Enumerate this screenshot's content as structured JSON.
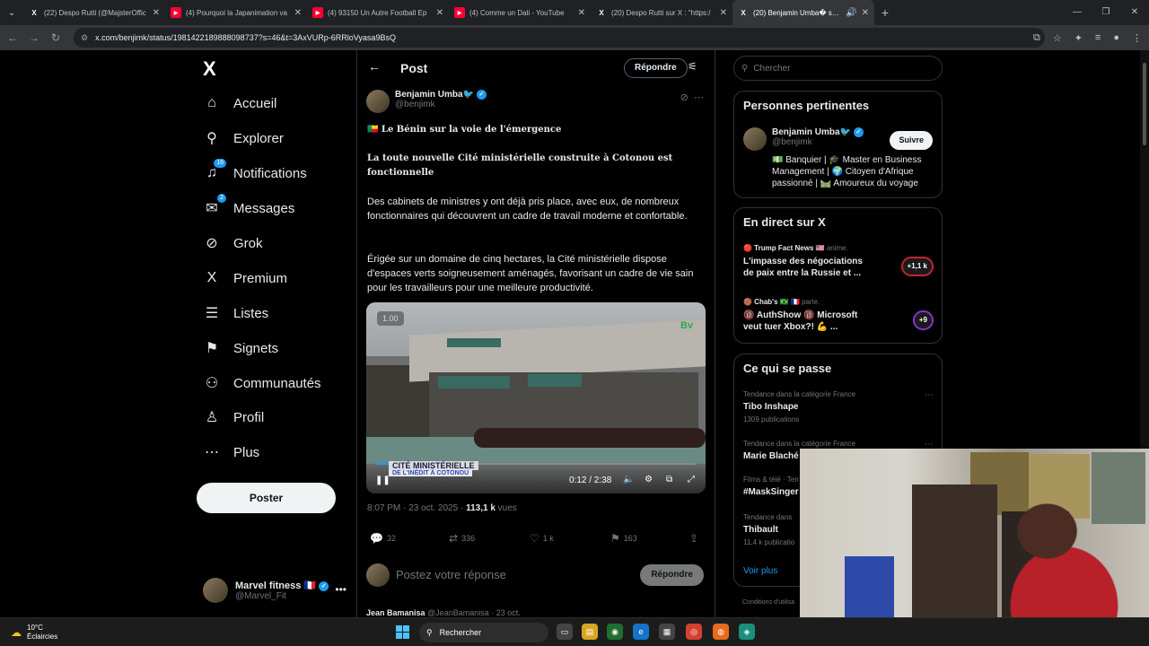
{
  "browser": {
    "tabs": [
      {
        "icon": "x-icon",
        "title": "(22) Despo Rutti (@MajsterOffic",
        "active": false
      },
      {
        "icon": "youtube-icon",
        "title": "(4) Pourquoi la Japanimation va",
        "active": false
      },
      {
        "icon": "youtube-icon",
        "title": "(4) 93150 Un Autre Football Ep",
        "active": false
      },
      {
        "icon": "youtube-icon",
        "title": "(4) Comme un Dali - YouTube",
        "active": false
      },
      {
        "icon": "x-icon",
        "title": "(20) Despo Rutti sur X : \"https:/",
        "active": false
      },
      {
        "icon": "x-icon",
        "title": "(20) Benjamin Umba� sur X",
        "active": true
      }
    ],
    "url": "x.com/benjimk/status/1981422189888098737?s=46&t=3AxVURp-6RRloVyasa9BsQ"
  },
  "nav": {
    "items": [
      {
        "label": "Accueil",
        "icon": "home-icon",
        "glyph": "⌂",
        "badge": ""
      },
      {
        "label": "Explorer",
        "icon": "search-icon",
        "glyph": "⚲",
        "badge": ""
      },
      {
        "label": "Notifications",
        "icon": "bell-icon",
        "glyph": "♫",
        "badge": "16"
      },
      {
        "label": "Messages",
        "icon": "mail-icon",
        "glyph": "✉",
        "badge": "2"
      },
      {
        "label": "Grok",
        "icon": "grok-icon",
        "glyph": "⊘",
        "badge": ""
      },
      {
        "label": "Premium",
        "icon": "x-icon",
        "glyph": "X",
        "badge": ""
      },
      {
        "label": "Listes",
        "icon": "list-icon",
        "glyph": "☰",
        "badge": ""
      },
      {
        "label": "Signets",
        "icon": "bookmark-icon",
        "glyph": "⚑",
        "badge": ""
      },
      {
        "label": "Communautés",
        "icon": "communities-icon",
        "glyph": "⚇",
        "badge": ""
      },
      {
        "label": "Profil",
        "icon": "profile-icon",
        "glyph": "♙",
        "badge": ""
      },
      {
        "label": "Plus",
        "icon": "more-icon",
        "glyph": "⋯",
        "badge": ""
      }
    ],
    "post_button": "Poster",
    "account": {
      "name": "Marvel fitness 🇫🇷",
      "handle": "@Marvel_Fit"
    }
  },
  "post": {
    "header_title": "Post",
    "header_reply": "Répondre",
    "author_name": "Benjamin Umba🐦",
    "author_handle": "@benjimk",
    "headline": "🇧🇯 Le Bénin sur la voie de l'émergence",
    "subheadline": "La toute nouvelle Cité ministérielle construite à Cotonou est fonctionnelle",
    "para1": "Des cabinets de ministres y ont déjà pris place, avec eux, de nombreux fonctionnaires qui découvrent un cadre de travail moderne et confortable.",
    "para2": "Érigée sur un domaine de cinq hectares, la Cité ministérielle dispose d'espaces verts soigneusement aménagés, favorisant un cadre de vie sain pour les travailleurs pour une meilleure productivité.",
    "video": {
      "speed": "1.00",
      "brand": "Bv",
      "caption1": "CITÉ MINISTÉRIELLE",
      "caption2": "DE L'INÉDIT À COTONOU",
      "time": "0:12 / 2:38",
      "progress": 0.076
    },
    "meta_time": "8:07 PM · 23 oct. 2025 · ",
    "views_count": "113,1 k",
    "views_label": " vues",
    "stats": {
      "replies": "32",
      "reposts": "336",
      "likes": "1 k",
      "bookmarks": "163"
    },
    "reply_placeholder": "Postez votre réponse",
    "reply_button": "Répondre",
    "next_reply_name": "Jean Bamanisa",
    "next_reply_meta": " @JeanBamanisa · 23 oct."
  },
  "sidebar": {
    "search_placeholder": "Chercher",
    "relevant": {
      "title": "Personnes pertinentes",
      "name": "Benjamin Umba🐦",
      "handle": "@benjimk",
      "follow": "Suivre",
      "bio": "💵 Banquier | 🎓 Master en Business Management | 🌍 Citoyen d'Afrique passionné | 🛤️ Amoureux du voyage"
    },
    "live": {
      "title": "En direct sur X",
      "items": [
        {
          "who": "🔴 Trump Fact News 🇺🇸 ",
          "role": "anime.",
          "title": "L'impasse des négociations de paix entre la Russie et ...",
          "badge": "+1,1 k"
        },
        {
          "who": "🟤 Chab's 🇧🇷 🇫🇷 ",
          "role": "parle.",
          "title": "🔞 AuthShow 🔞 Microsoft veut tuer Xbox?! 💪 ...",
          "badge": "+9"
        }
      ]
    },
    "trends": {
      "title": "Ce qui se passe",
      "items": [
        {
          "cat": "Tendance dans la catégorie France",
          "name": "Tibo Inshape",
          "posts": "1309 publications"
        },
        {
          "cat": "Tendance dans la catégorie France",
          "name": "Marie Blaché",
          "posts": ""
        },
        {
          "cat": "Films & télé · Ten",
          "name": "#MaskSinger",
          "posts": ""
        },
        {
          "cat": "Tendance dans",
          "name": "Thibault",
          "posts": "11,4 k publicatio"
        }
      ],
      "see_more": "Voir plus"
    },
    "conditions": "Conditions d'utilisa"
  },
  "taskbar": {
    "temp": "10°C",
    "weather": "Éclaircies",
    "search": "Rechercher"
  },
  "colors": {
    "accent": "#1d9bf0",
    "background": "#000000",
    "border": "#2f3336",
    "muted": "#71767b"
  }
}
